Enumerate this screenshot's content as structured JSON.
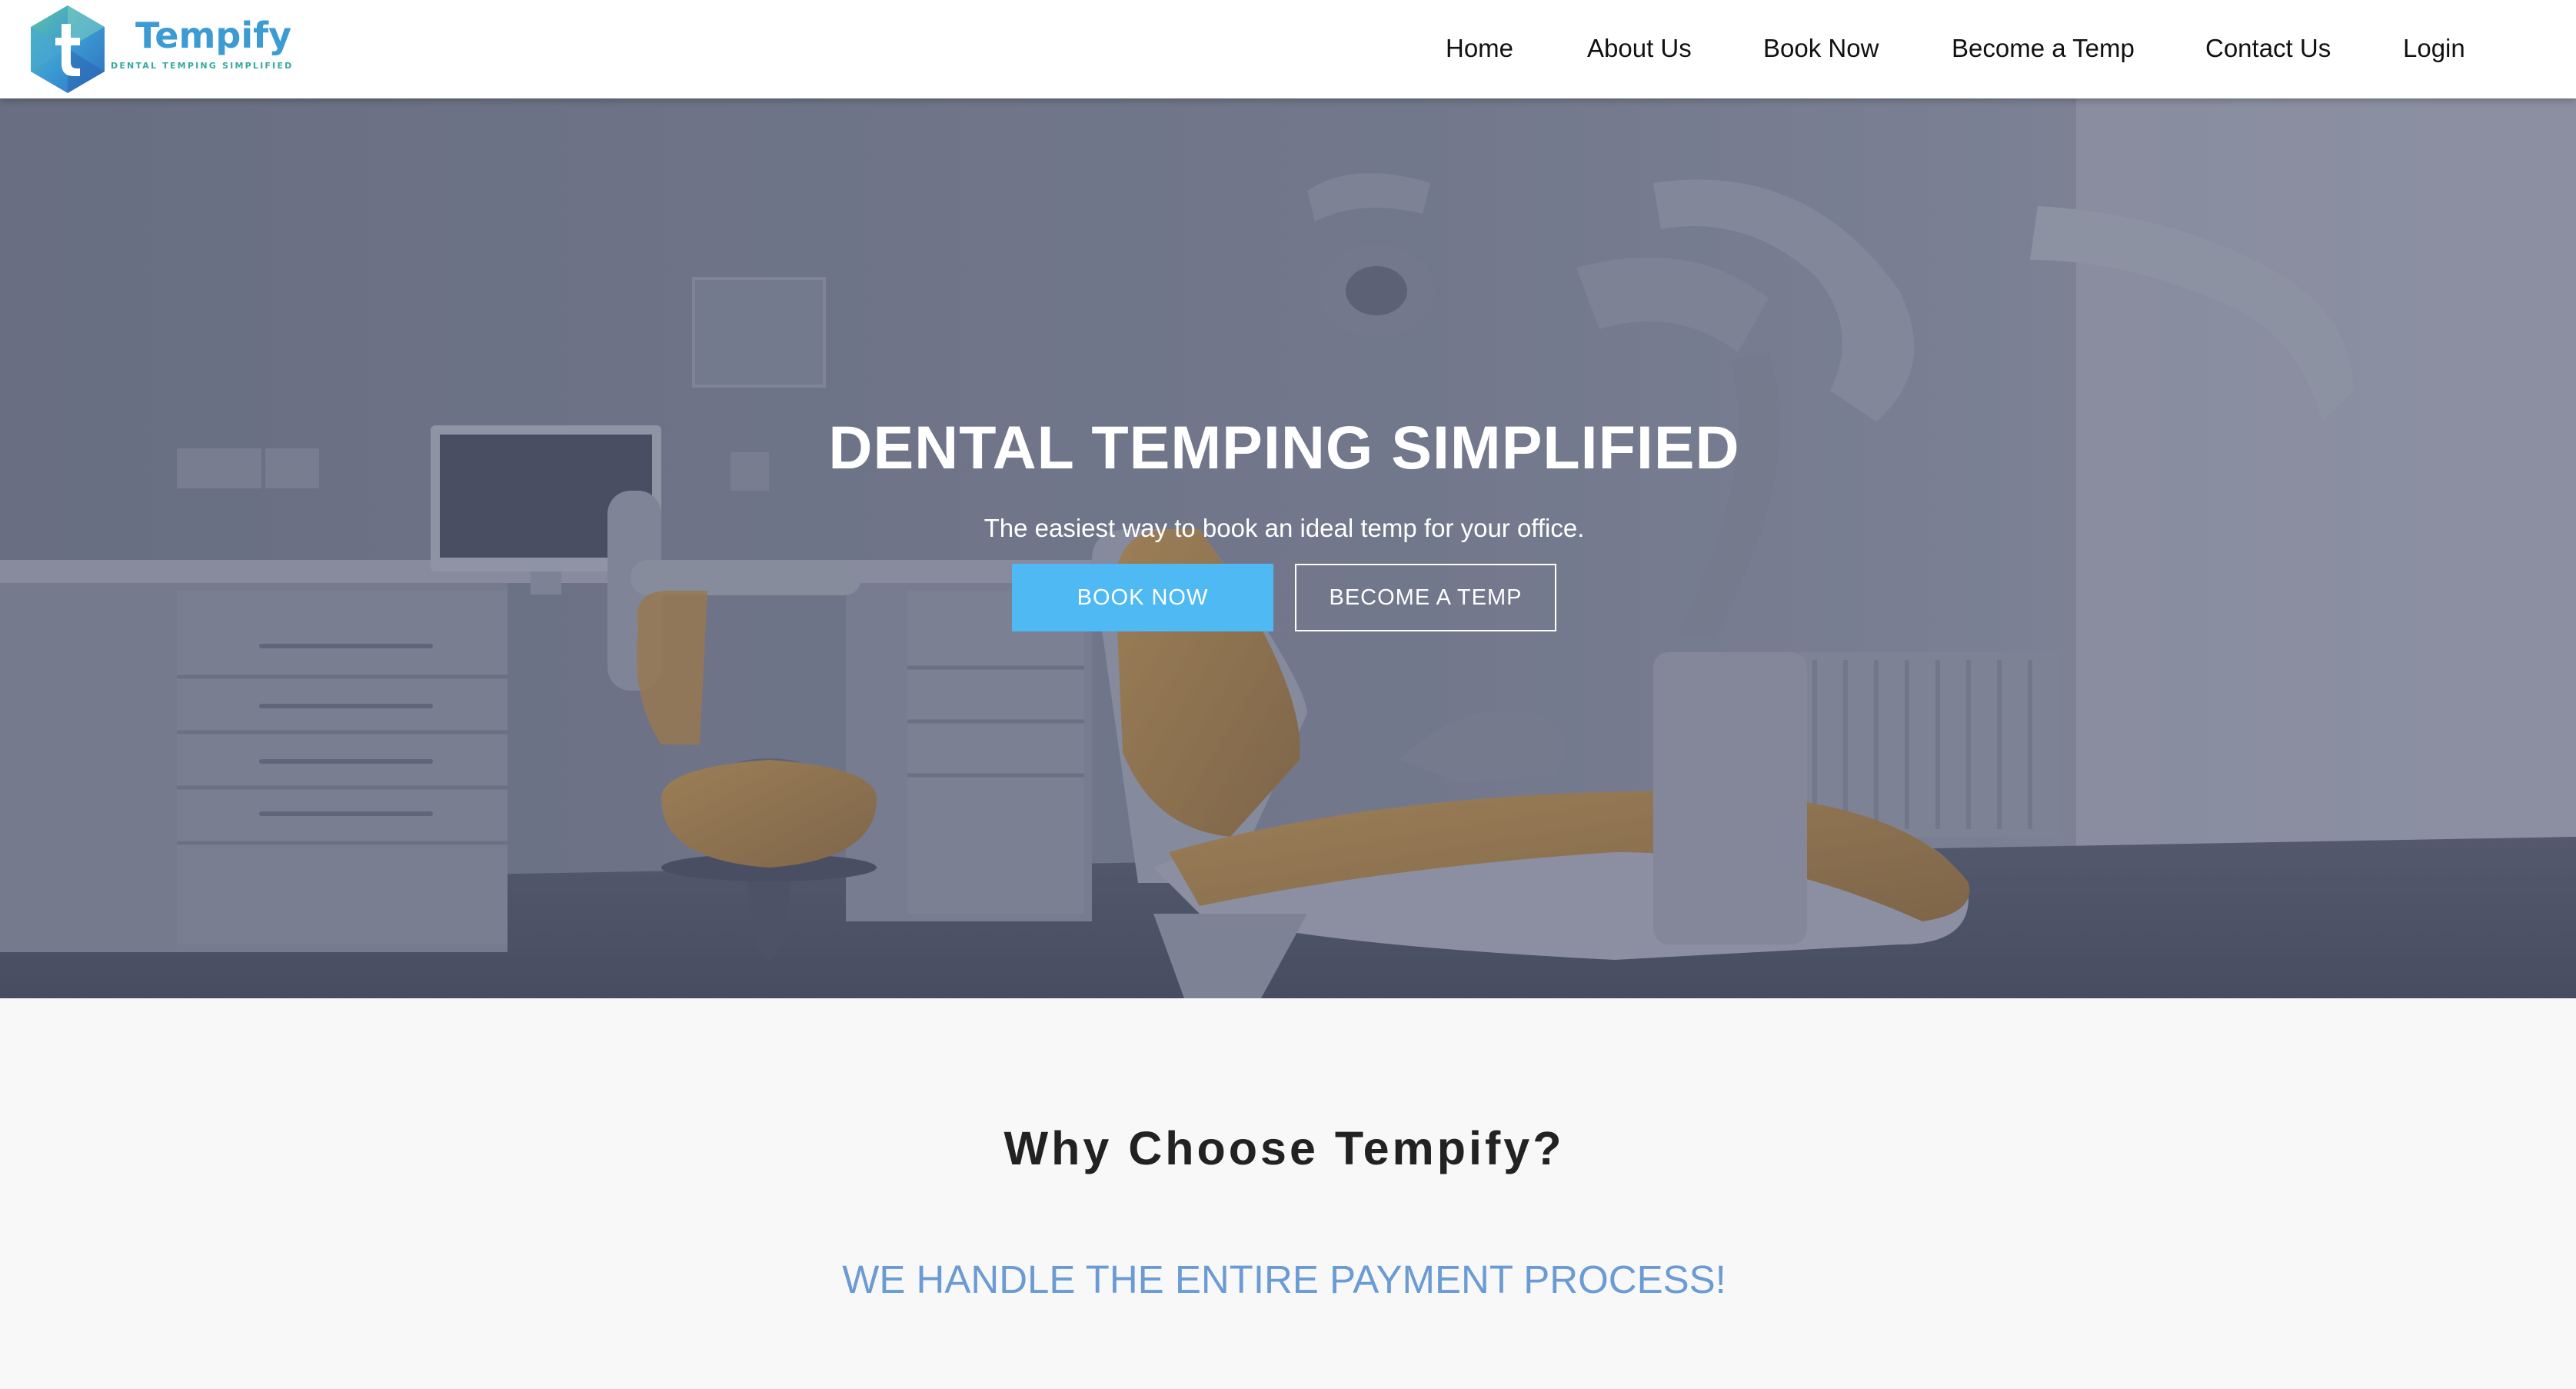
{
  "brand": {
    "name": "Tempify",
    "tagline": "DENTAL TEMPING SIMPLIFIED",
    "logo_letter": "t",
    "color_primary": "#3c9bd3",
    "color_secondary": "#35a9a0"
  },
  "nav": {
    "items": [
      {
        "label": "Home"
      },
      {
        "label": "About Us"
      },
      {
        "label": "Book Now"
      },
      {
        "label": "Become a Temp"
      },
      {
        "label": "Contact Us"
      },
      {
        "label": "Login"
      }
    ]
  },
  "hero": {
    "title": "DENTAL TEMPING SIMPLIFIED",
    "subtitle": "The easiest way to book an ideal temp for your office.",
    "primary_button": "BOOK NOW",
    "secondary_button": "BECOME A TEMP",
    "button_color": "#4fb9f3",
    "background_image": "dental office with orange dental chair, grey overlay"
  },
  "why": {
    "title": "Why Choose Tempify?",
    "feature": "WE HANDLE THE ENTIRE PAYMENT PROCESS!",
    "feature_color": "#6a9bd3"
  }
}
